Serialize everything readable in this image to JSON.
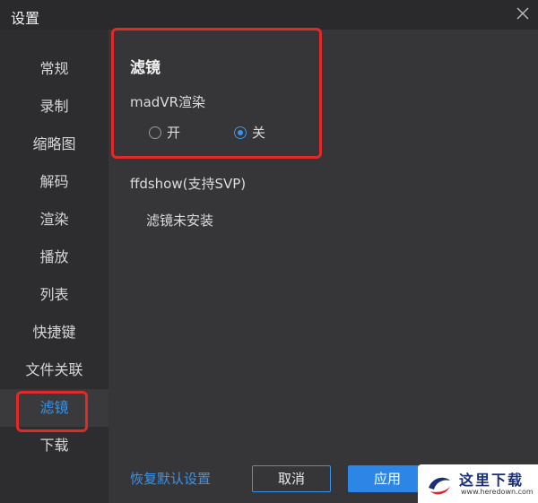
{
  "window": {
    "title": "设置"
  },
  "sidebar": {
    "items": [
      {
        "label": "常规",
        "active": false
      },
      {
        "label": "录制",
        "active": false
      },
      {
        "label": "缩略图",
        "active": false
      },
      {
        "label": "解码",
        "active": false
      },
      {
        "label": "渲染",
        "active": false
      },
      {
        "label": "播放",
        "active": false
      },
      {
        "label": "列表",
        "active": false
      },
      {
        "label": "快捷键",
        "active": false
      },
      {
        "label": "文件关联",
        "active": false
      },
      {
        "label": "滤镜",
        "active": true
      },
      {
        "label": "下载",
        "active": false
      }
    ]
  },
  "main": {
    "section_title": "滤镜",
    "madvr": {
      "label": "madVR渲染",
      "options": [
        {
          "label": "开",
          "checked": false
        },
        {
          "label": "关",
          "checked": true
        }
      ]
    },
    "ffdshow": {
      "label": "ffdshow(支持SVP)",
      "status": "滤镜未安装"
    }
  },
  "footer": {
    "reset_label": "恢复默认设置",
    "cancel_label": "取消",
    "apply_label": "应用"
  },
  "watermark": {
    "text": "这里下载",
    "url": "www.heredown.com"
  },
  "colors": {
    "accent": "#3a93e8",
    "highlight_border": "#e02a2a",
    "sidebar_bg": "#2d2d2f",
    "main_bg": "#363638"
  }
}
